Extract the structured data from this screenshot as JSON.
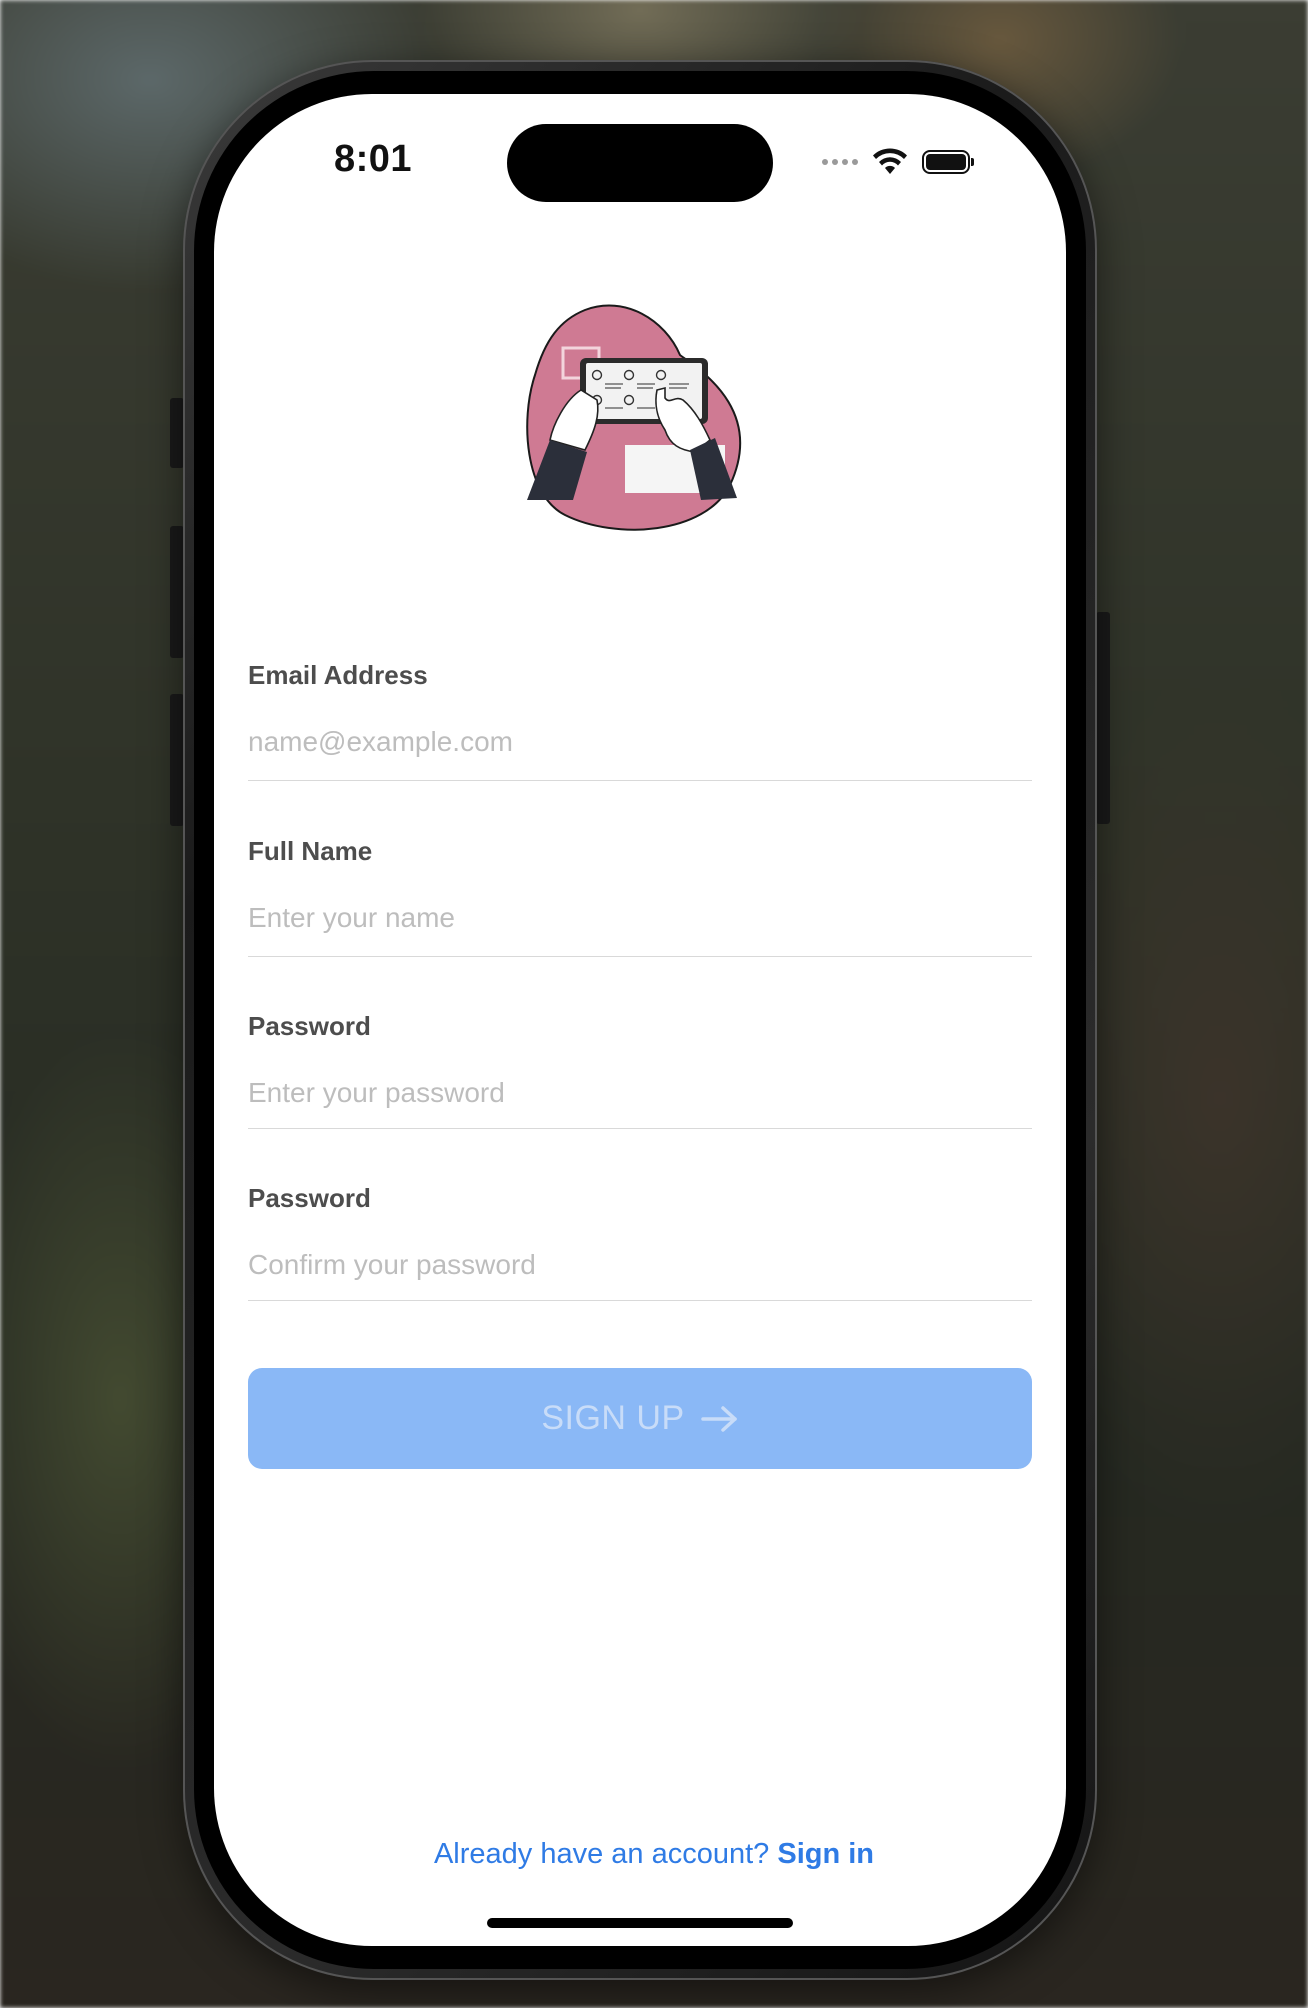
{
  "status_bar": {
    "time": "8:01",
    "icons": [
      "cellular-dots-icon",
      "wifi-icon",
      "battery-icon"
    ]
  },
  "illustration": {
    "icon": "tablet-hands-illustration",
    "accent_color": "#cf7a93"
  },
  "form": {
    "email": {
      "label": "Email Address",
      "placeholder": "name@example.com"
    },
    "full_name": {
      "label": "Full Name",
      "placeholder": "Enter your name"
    },
    "password": {
      "label": "Password",
      "placeholder": "Enter your password"
    },
    "confirm_password": {
      "label": "Password",
      "placeholder": "Confirm your password"
    }
  },
  "signup_button": {
    "label": "SIGN UP",
    "icon": "arrow-right-icon",
    "color": "#8ab8f6",
    "state": "disabled"
  },
  "footer": {
    "prompt": "Already have an account?",
    "link": "Sign in",
    "link_color": "#2f7be5"
  }
}
